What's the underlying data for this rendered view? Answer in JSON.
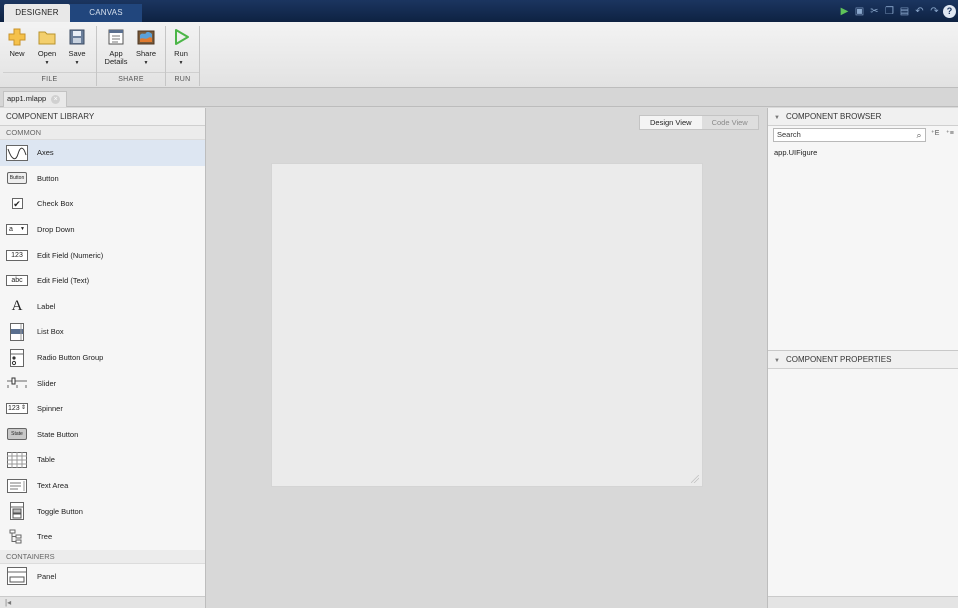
{
  "tabs": {
    "designer": "DESIGNER",
    "canvas": "CANVAS"
  },
  "quick_access": [
    "run-icon",
    "save-icon",
    "cut-icon",
    "copy-icon",
    "paste-icon",
    "undo-icon",
    "redo-icon",
    "help-icon"
  ],
  "toolstrip": {
    "new_label": "New",
    "open_label": "Open",
    "save_label": "Save",
    "app_details_label_1": "App",
    "app_details_label_2": "Details",
    "share_label": "Share",
    "run_label": "Run",
    "section_file": "FILE",
    "section_share": "SHARE",
    "section_run": "RUN"
  },
  "document_tab": {
    "label": "app1.mlapp"
  },
  "library": {
    "header": "COMPONENT LIBRARY",
    "section_common": "COMMON",
    "section_containers": "CONTAINERS",
    "items": [
      {
        "label": "Axes",
        "icon": "axes-icon"
      },
      {
        "label": "Button",
        "icon": "button-icon"
      },
      {
        "label": "Check Box",
        "icon": "checkbox-icon"
      },
      {
        "label": "Drop Down",
        "icon": "dropdown-icon"
      },
      {
        "label": "Edit Field (Numeric)",
        "icon": "edit-field-numeric-icon"
      },
      {
        "label": "Edit Field (Text)",
        "icon": "edit-field-text-icon"
      },
      {
        "label": "Label",
        "icon": "label-icon"
      },
      {
        "label": "List Box",
        "icon": "listbox-icon"
      },
      {
        "label": "Radio Button Group",
        "icon": "radio-group-icon"
      },
      {
        "label": "Slider",
        "icon": "slider-icon"
      },
      {
        "label": "Spinner",
        "icon": "spinner-icon"
      },
      {
        "label": "State Button",
        "icon": "state-button-icon"
      },
      {
        "label": "Table",
        "icon": "table-icon"
      },
      {
        "label": "Text Area",
        "icon": "text-area-icon"
      },
      {
        "label": "Toggle Button",
        "icon": "toggle-button-icon"
      },
      {
        "label": "Tree",
        "icon": "tree-icon"
      }
    ],
    "containers": [
      {
        "label": "Panel",
        "icon": "panel-icon"
      }
    ],
    "icon_text": {
      "button": "Button",
      "dropdown": "a",
      "numeric": "123",
      "text": "abc",
      "label": "A",
      "spinner": "123",
      "state": "State",
      "title": "Title"
    }
  },
  "canvas": {
    "design_view": "Design View",
    "code_view": "Code View"
  },
  "browser": {
    "header": "COMPONENT BROWSER",
    "search_placeholder": "Search",
    "tree_root": "app.UIFigure"
  },
  "properties": {
    "header": "COMPONENT PROPERTIES"
  },
  "colors": {
    "accent": "#1b3560",
    "run_green": "#4cb648",
    "selected_row": "#dde6f2"
  }
}
